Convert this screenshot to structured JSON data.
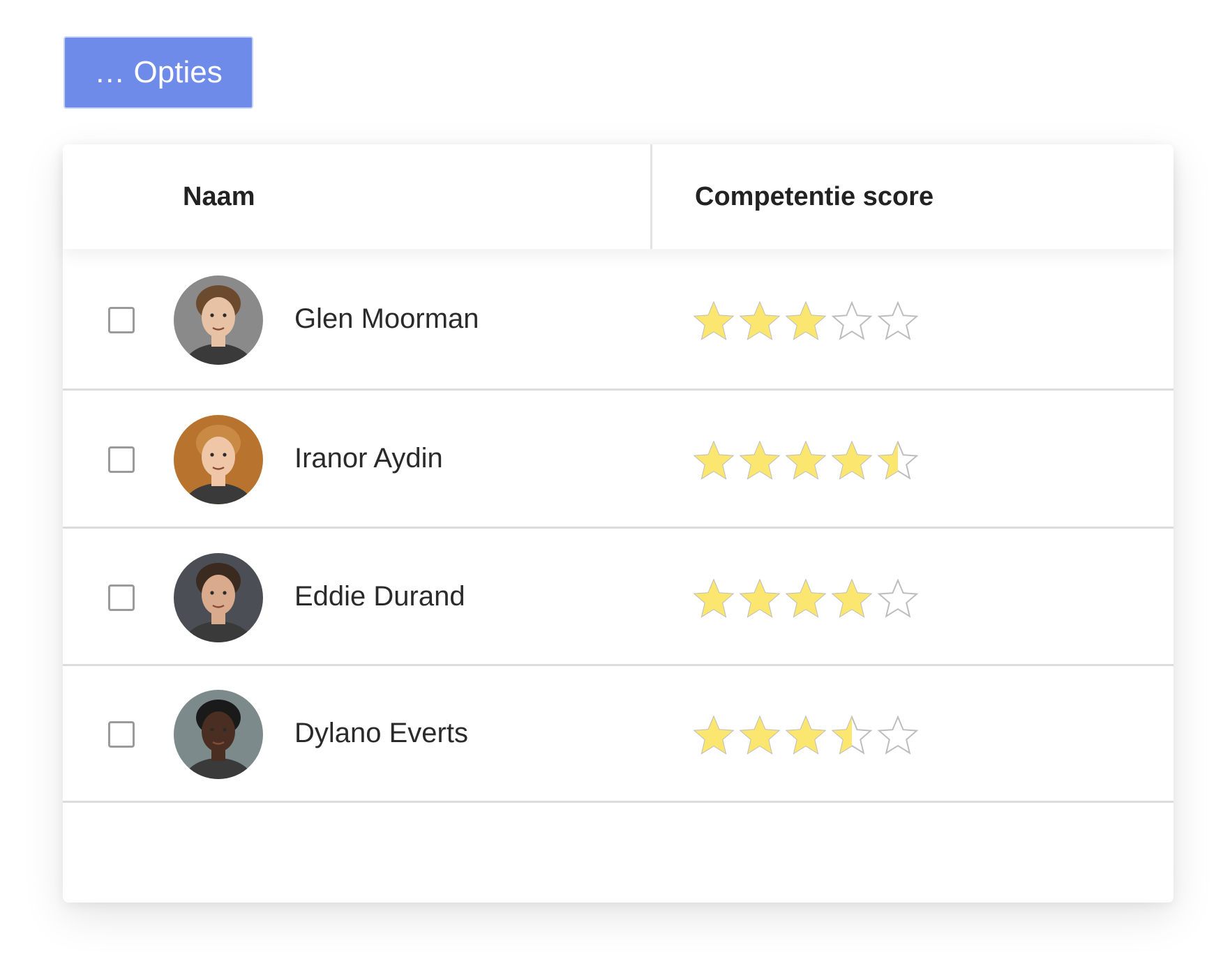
{
  "toolbar": {
    "options_label": "… Opties"
  },
  "table": {
    "columns": {
      "name": "Naam",
      "score": "Competentie score"
    },
    "rows": [
      {
        "name": "Glen Moorman",
        "rating": 3,
        "max": 5,
        "avatar_bg": "#8a8a8a",
        "skin": "#e8c2a4",
        "hair": "#6b4a2e"
      },
      {
        "name": "Iranor Aydin",
        "rating": 4.5,
        "max": 5,
        "avatar_bg": "#b8732f",
        "skin": "#efc6a6",
        "hair": "#c98a45"
      },
      {
        "name": "Eddie Durand",
        "rating": 4,
        "max": 5,
        "avatar_bg": "#4b4f55",
        "skin": "#d9ab8c",
        "hair": "#3b2a20"
      },
      {
        "name": "Dylano Everts",
        "rating": 3.5,
        "max": 5,
        "avatar_bg": "#7d8a8c",
        "skin": "#4a2e22",
        "hair": "#1a1a1a"
      }
    ]
  },
  "colors": {
    "button": "#6e8bea",
    "star_filled": "#fbe66f",
    "star_empty_stroke": "#bdbdbd",
    "row_divider": "#dcdcdc"
  }
}
